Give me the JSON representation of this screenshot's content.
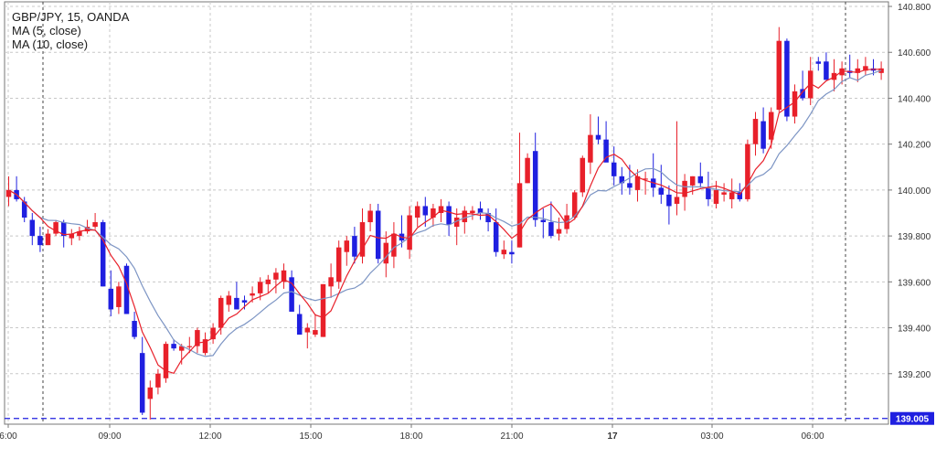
{
  "legend": {
    "symbol_line": "GBP/JPY, 15, OANDA",
    "ma_fast_label": "MA (5, close)",
    "ma_slow_label": "MA (10, close)"
  },
  "colors": {
    "up_candle": "#e8202a",
    "down_candle": "#1f1fe0",
    "ma_fast": "#e8202a",
    "ma_slow": "#7d95c4",
    "grid": "#c8c8c8",
    "price_line": "#1f1fe0",
    "price_badge_bg": "#1f1fe0",
    "price_badge_text": "#ffffff"
  },
  "chart_data": {
    "type": "candlestick",
    "symbol": "GBP/JPY",
    "timeframe": "15",
    "broker": "OANDA",
    "ylim": [
      138.98,
      140.82
    ],
    "y_ticks": [
      "139.200",
      "139.400",
      "139.600",
      "139.800",
      "140.000",
      "140.200",
      "140.400",
      "140.600",
      "140.800"
    ],
    "x_ticks": [
      {
        "label": "6:00",
        "bold": false
      },
      {
        "label": "09:00",
        "bold": false
      },
      {
        "label": "12:00",
        "bold": false
      },
      {
        "label": "15:00",
        "bold": false
      },
      {
        "label": "18:00",
        "bold": false
      },
      {
        "label": "21:00",
        "bold": false
      },
      {
        "label": "17",
        "bold": true
      },
      {
        "label": "03:00",
        "bold": false
      },
      {
        "label": "06:00",
        "bold": false
      }
    ],
    "current_price": "139.005",
    "session_markers": [
      "07:00",
      "07:00"
    ],
    "grid": true,
    "ohlc": [
      [
        139.97,
        140.06,
        139.93,
        140.0
      ],
      [
        140.0,
        140.06,
        139.95,
        139.96
      ],
      [
        139.95,
        139.97,
        139.86,
        139.88
      ],
      [
        139.87,
        139.9,
        139.76,
        139.8
      ],
      [
        139.8,
        139.84,
        139.73,
        139.76
      ],
      [
        139.76,
        139.83,
        139.76,
        139.81
      ],
      [
        139.81,
        139.87,
        139.8,
        139.86
      ],
      [
        139.86,
        139.87,
        139.75,
        139.8
      ],
      [
        139.79,
        139.83,
        139.76,
        139.81
      ],
      [
        139.8,
        139.84,
        139.78,
        139.82
      ],
      [
        139.82,
        139.87,
        139.81,
        139.84
      ],
      [
        139.84,
        139.9,
        139.83,
        139.86
      ],
      [
        139.86,
        139.87,
        139.58,
        139.58
      ],
      [
        139.57,
        139.65,
        139.45,
        139.48
      ],
      [
        139.49,
        139.6,
        139.46,
        139.58
      ],
      [
        139.67,
        139.68,
        139.46,
        139.46
      ],
      [
        139.43,
        139.47,
        139.35,
        139.36
      ],
      [
        139.29,
        139.36,
        139.02,
        139.03
      ],
      [
        139.09,
        139.17,
        139.0,
        139.14
      ],
      [
        139.14,
        139.22,
        139.11,
        139.2
      ],
      [
        139.18,
        139.34,
        139.16,
        139.33
      ],
      [
        139.33,
        139.35,
        139.3,
        139.31
      ],
      [
        139.3,
        139.33,
        139.24,
        139.32
      ],
      [
        139.32,
        139.36,
        139.29,
        139.32
      ],
      [
        139.32,
        139.4,
        139.29,
        139.39
      ],
      [
        139.29,
        139.38,
        139.28,
        139.35
      ],
      [
        139.35,
        139.42,
        139.33,
        139.4
      ],
      [
        139.4,
        139.54,
        139.37,
        139.53
      ],
      [
        139.5,
        139.56,
        139.47,
        139.54
      ],
      [
        139.53,
        139.6,
        139.48,
        139.48
      ],
      [
        139.52,
        139.54,
        139.48,
        139.51
      ],
      [
        139.54,
        139.58,
        139.51,
        139.55
      ],
      [
        139.55,
        139.62,
        139.52,
        139.6
      ],
      [
        139.59,
        139.63,
        139.55,
        139.61
      ],
      [
        139.61,
        139.66,
        139.55,
        139.64
      ],
      [
        139.6,
        139.68,
        139.57,
        139.65
      ],
      [
        139.62,
        139.65,
        139.48,
        139.47
      ],
      [
        139.46,
        139.5,
        139.38,
        139.37
      ],
      [
        139.38,
        139.42,
        139.31,
        139.4
      ],
      [
        139.37,
        139.46,
        139.36,
        139.39
      ],
      [
        139.36,
        139.59,
        139.36,
        139.59
      ],
      [
        139.58,
        139.68,
        139.53,
        139.62
      ],
      [
        139.6,
        139.78,
        139.57,
        139.75
      ],
      [
        139.73,
        139.8,
        139.67,
        139.78
      ],
      [
        139.8,
        139.84,
        139.68,
        139.71
      ],
      [
        139.71,
        139.92,
        139.68,
        139.86
      ],
      [
        139.86,
        139.94,
        139.82,
        139.91
      ],
      [
        139.91,
        139.94,
        139.68,
        139.7
      ],
      [
        139.68,
        139.82,
        139.62,
        139.77
      ],
      [
        139.71,
        139.86,
        139.66,
        139.81
      ],
      [
        139.81,
        139.89,
        139.75,
        139.78
      ],
      [
        139.74,
        139.93,
        139.7,
        139.89
      ],
      [
        139.88,
        139.95,
        139.84,
        139.93
      ],
      [
        139.93,
        139.97,
        139.84,
        139.89
      ],
      [
        139.88,
        139.94,
        139.84,
        139.92
      ],
      [
        139.9,
        139.96,
        139.86,
        139.93
      ],
      [
        139.93,
        139.95,
        139.8,
        139.85
      ],
      [
        139.84,
        139.92,
        139.76,
        139.88
      ],
      [
        139.86,
        139.93,
        139.81,
        139.91
      ],
      [
        139.9,
        139.93,
        139.87,
        139.91
      ],
      [
        139.92,
        139.95,
        139.87,
        139.9
      ],
      [
        139.9,
        139.92,
        139.82,
        139.86
      ],
      [
        139.86,
        139.92,
        139.71,
        139.73
      ],
      [
        139.72,
        139.78,
        139.7,
        139.74
      ],
      [
        139.73,
        139.78,
        139.68,
        139.72
      ],
      [
        139.75,
        140.25,
        139.75,
        140.03
      ],
      [
        140.03,
        140.16,
        140.03,
        140.14
      ],
      [
        140.17,
        140.25,
        139.84,
        139.87
      ],
      [
        139.87,
        139.92,
        139.79,
        139.86
      ],
      [
        139.86,
        139.95,
        139.79,
        139.8
      ],
      [
        139.81,
        139.88,
        139.78,
        139.83
      ],
      [
        139.83,
        139.94,
        139.81,
        139.89
      ],
      [
        139.88,
        140.0,
        139.87,
        139.99
      ],
      [
        139.99,
        140.15,
        139.97,
        140.14
      ],
      [
        140.12,
        140.33,
        140.07,
        140.24
      ],
      [
        140.24,
        140.32,
        140.2,
        140.22
      ],
      [
        140.22,
        140.3,
        140.14,
        140.12
      ],
      [
        140.12,
        140.19,
        140.02,
        140.06
      ],
      [
        140.06,
        140.1,
        139.98,
        140.03
      ],
      [
        140.03,
        140.11,
        139.98,
        140.01
      ],
      [
        140.0,
        140.09,
        139.95,
        140.06
      ],
      [
        140.05,
        140.08,
        139.98,
        140.05
      ],
      [
        140.05,
        140.16,
        139.97,
        140.01
      ],
      [
        140.01,
        140.11,
        139.94,
        139.98
      ],
      [
        139.98,
        140.02,
        139.85,
        139.93
      ],
      [
        139.94,
        140.3,
        139.89,
        139.97
      ],
      [
        139.97,
        140.07,
        139.91,
        140.04
      ],
      [
        140.02,
        140.06,
        139.98,
        140.06
      ],
      [
        140.06,
        140.12,
        140.01,
        140.03
      ],
      [
        140.01,
        140.08,
        139.93,
        139.96
      ],
      [
        139.94,
        140.04,
        139.92,
        140.0
      ],
      [
        139.98,
        140.03,
        139.95,
        139.99
      ],
      [
        139.96,
        140.05,
        139.92,
        139.99
      ],
      [
        139.99,
        140.03,
        139.95,
        139.96
      ],
      [
        139.96,
        140.22,
        139.95,
        140.2
      ],
      [
        140.2,
        140.34,
        140.15,
        140.31
      ],
      [
        140.3,
        140.36,
        140.16,
        140.18
      ],
      [
        140.22,
        140.36,
        140.18,
        140.34
      ],
      [
        140.35,
        140.71,
        140.34,
        140.65
      ],
      [
        140.65,
        140.66,
        140.3,
        140.32
      ],
      [
        140.32,
        140.46,
        140.29,
        140.43
      ],
      [
        140.44,
        140.52,
        140.39,
        140.4
      ],
      [
        140.4,
        140.58,
        140.37,
        140.52
      ],
      [
        140.56,
        140.58,
        140.52,
        140.55
      ],
      [
        140.56,
        140.6,
        140.48,
        140.48
      ],
      [
        140.48,
        140.57,
        140.43,
        140.51
      ],
      [
        140.5,
        140.56,
        140.46,
        140.53
      ],
      [
        140.52,
        140.59,
        140.49,
        140.51
      ],
      [
        140.51,
        140.57,
        140.47,
        140.53
      ],
      [
        140.52,
        140.58,
        140.5,
        140.54
      ],
      [
        140.53,
        140.57,
        140.5,
        140.52
      ],
      [
        140.51,
        140.56,
        140.48,
        140.53
      ]
    ]
  }
}
